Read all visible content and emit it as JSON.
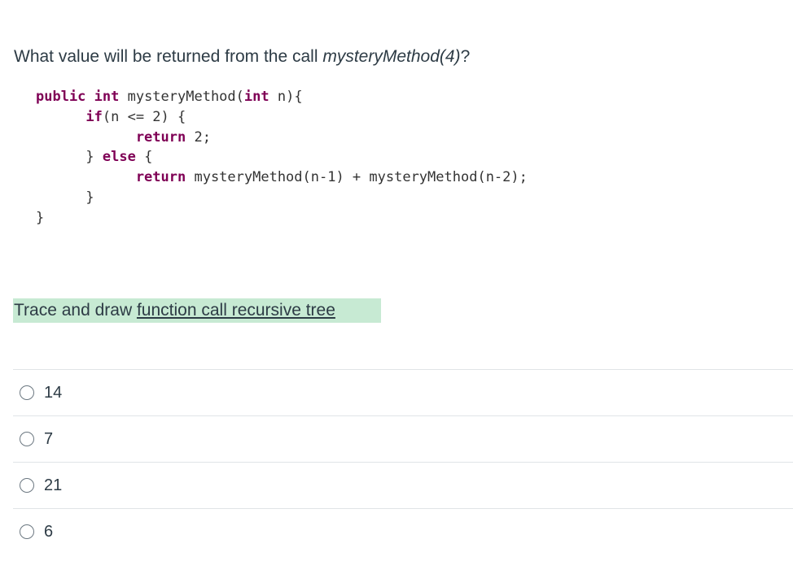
{
  "question": {
    "prefix": "What value will be returned from the call ",
    "call": "mysteryMethod(4)",
    "suffix": "?"
  },
  "code": {
    "lines": [
      [
        {
          "t": "public int ",
          "k": true
        },
        {
          "t": "mysteryMethod(",
          "k": false
        },
        {
          "t": "int ",
          "k": true
        },
        {
          "t": "n){",
          "k": false
        }
      ],
      [
        {
          "t": "      if",
          "k": true
        },
        {
          "t": "(n <= 2) {",
          "k": false
        }
      ],
      [
        {
          "t": "            return ",
          "k": true
        },
        {
          "t": "2;",
          "k": false
        }
      ],
      [
        {
          "t": "      } ",
          "k": false
        },
        {
          "t": "else ",
          "k": true
        },
        {
          "t": "{",
          "k": false
        }
      ],
      [
        {
          "t": "            return ",
          "k": true
        },
        {
          "t": "mysteryMethod(n-1) + mysteryMethod(n-2);",
          "k": false
        }
      ],
      [
        {
          "t": "      }",
          "k": false
        }
      ],
      [
        {
          "t": "}",
          "k": false
        }
      ]
    ]
  },
  "hint": {
    "text": "Trace and draw ",
    "link_text": "function call recursive tree"
  },
  "answers": [
    "14",
    "7",
    "21",
    "6"
  ]
}
